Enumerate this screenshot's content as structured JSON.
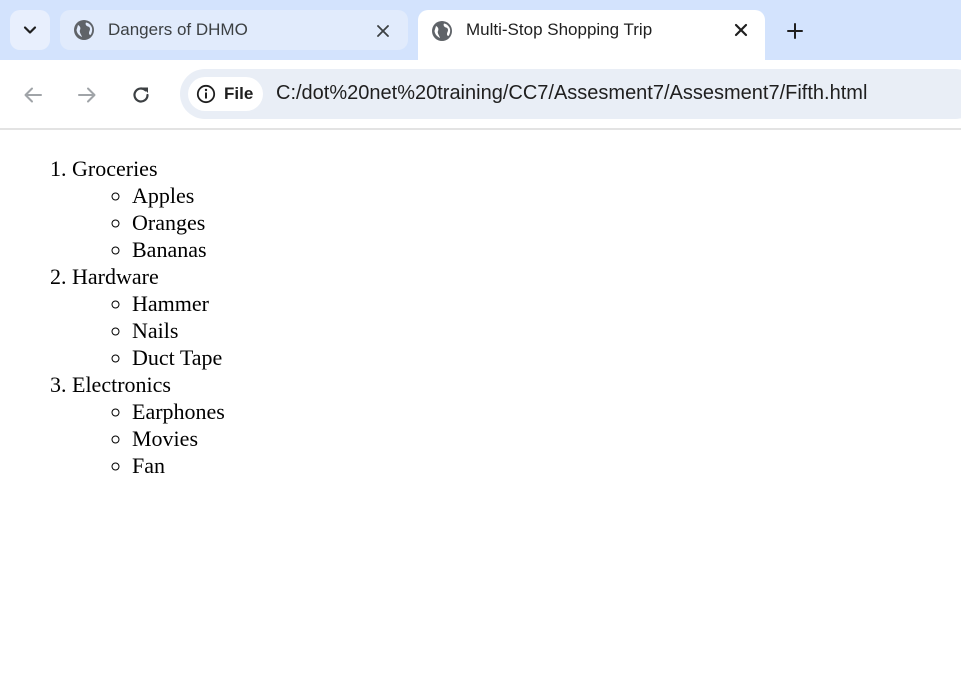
{
  "browser": {
    "tabs": [
      {
        "title": "Dangers of DHMO",
        "active": false,
        "icon": "globe-icon"
      },
      {
        "title": "Multi-Stop Shopping Trip",
        "active": true,
        "icon": "globe-icon"
      }
    ],
    "address_bar": {
      "chip_label": "File",
      "url": "C:/dot%20net%20training/CC7/Assesment7/Assesment7/Fifth.html"
    },
    "colors": {
      "tabstrip": "#d3e3fd",
      "omnibox": "#e9eef6"
    }
  },
  "page": {
    "list": [
      {
        "label": "Groceries",
        "items": [
          "Apples",
          "Oranges",
          "Bananas"
        ]
      },
      {
        "label": "Hardware",
        "items": [
          "Hammer",
          "Nails",
          "Duct Tape"
        ]
      },
      {
        "label": "Electronics",
        "items": [
          "Earphones",
          "Movies",
          "Fan"
        ]
      }
    ]
  }
}
